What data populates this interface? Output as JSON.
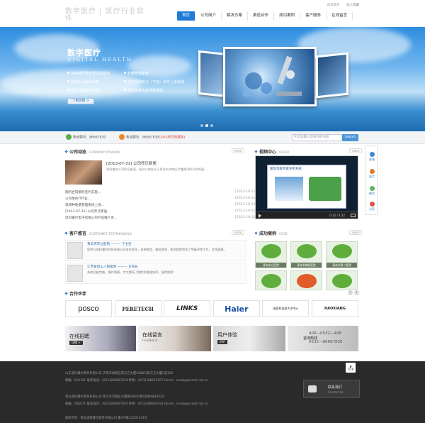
{
  "header": {
    "logo_text": "数字医疗 | 医疗行业软件",
    "top_links": [
      "设为首页",
      "加入收藏"
    ],
    "nav": [
      "首页",
      "公司简介",
      "解决方案",
      "渠道合作",
      "成功案例",
      "客户服务",
      "在线留言"
    ]
  },
  "banner": {
    "title": "数字医疗",
    "subtitle": "DIGITAL HEALTH",
    "features": [
      "单病种质量管理监测系统",
      "科教管理系统",
      "医德医风考评系统",
      "院内网络安全（不良）事件上报系统",
      "医疗行政综合管理",
      "医院等级专家评审系统"
    ],
    "more_button": "了解详情 >",
    "slide_count": 3,
    "active_slide": 2
  },
  "hotline": {
    "label1": "售前服务：86667830",
    "label2": "售后服务：86667830",
    "note": "(24小时为您服务)",
    "search_placeholder": "在这里输入您要找的内容",
    "search_button": "Search"
  },
  "company_news": {
    "title": "公司动态",
    "title_en": "COMPANY DYNAMIC",
    "more": "more",
    "items": [
      {
        "text": "[2013-07-31] 公司乔迁新居",
        "date": ""
      },
      {
        "text": "随机合同顺利签约实施…",
        "date": "[2013-10-11]"
      },
      {
        "text": "公司举办IT行业…",
        "date": "[2013-10-11]"
      },
      {
        "text": "单病种质量管理系统上线…",
        "date": "[2013-10-11]"
      },
      {
        "text": "[2013-07-31] 公司乔迁新居",
        "date": "[2013-10-11]"
      },
      {
        "text": "思科睿尔电子有限公司产品推介会…",
        "date": "[2013-10-11]"
      }
    ]
  },
  "video_center": {
    "title": "视频中心",
    "title_en": "VIDEO",
    "more": "more",
    "player_title": "医院等级专家评审系统",
    "time": "0:32 / 4:32"
  },
  "right_bar": [
    {
      "label": "客服",
      "color": "#3c8ad6"
    },
    {
      "label": "留言",
      "color": "#e07b2a"
    },
    {
      "label": "微信",
      "color": "#5cb85c"
    },
    {
      "label": "分享",
      "color": "#d9534f"
    }
  ],
  "testimonials": {
    "title": "客户感言",
    "title_en": "CUSTOMER TESTIMONIALS",
    "more": "more",
    "items": [
      {
        "name": "青岛市市立医院 ——— 丁主任",
        "text": "医院与思科睿尔科技有限公司合作多年，系统稳定、服务周到，帮助我院完成了等级评审工作，非常满意。"
      },
      {
        "name": "江苏省昆山人民医院 ——— 方院长",
        "text": "系统功能完善，操作简便，大大提高了我院的管理效率，值得推荐！"
      }
    ]
  },
  "cases": {
    "title": "成功案例",
    "title_en": "CASE",
    "more": "more",
    "items": [
      "青岛市立医院",
      "青岛市胸科医院",
      "青岛市第二医院"
    ]
  },
  "partners": {
    "title": "合作伙伴",
    "logos": [
      "posco",
      "PERETECH",
      "LINKS",
      "Haier",
      "国家科技部大学中心",
      "HAOXIANG"
    ]
  },
  "promos": [
    {
      "title": "在线招聘",
      "en": "",
      "button": "详情 >"
    },
    {
      "title": "在线留言",
      "en": "Feedback",
      "button": ""
    },
    {
      "title": "用户体验",
      "en": "",
      "button": "ERP"
    },
    {
      "title": "咨询热线",
      "en": "",
      "button": "",
      "phone1": "400—0532—498",
      "phone2": "0532—86667830"
    }
  ],
  "footer": {
    "lines": [
      "山东思科睿尔软件有限公司 济南市高新区新东方大厦2008号新东方大厦C座202",
      "邮编：250101  联系电话：(0531)86667830  传真：(0531)88515207  Email：ecode@ecode.net.cn",
      "青岛思科睿尔软件有限公司  青岛市市南区宁夏路288号青岛软件园48号2F",
      "邮编：266071  联系电话：(0532)86667830  传真：(0532)86669191  Email：ecode@ecode.net.cn",
      "版权所有：青岛思科睿尔软件有限公司    鲁ICP备12001534号"
    ],
    "top_button": "TOP",
    "contact_label": "联系我们",
    "contact_en": "Contact Us"
  }
}
